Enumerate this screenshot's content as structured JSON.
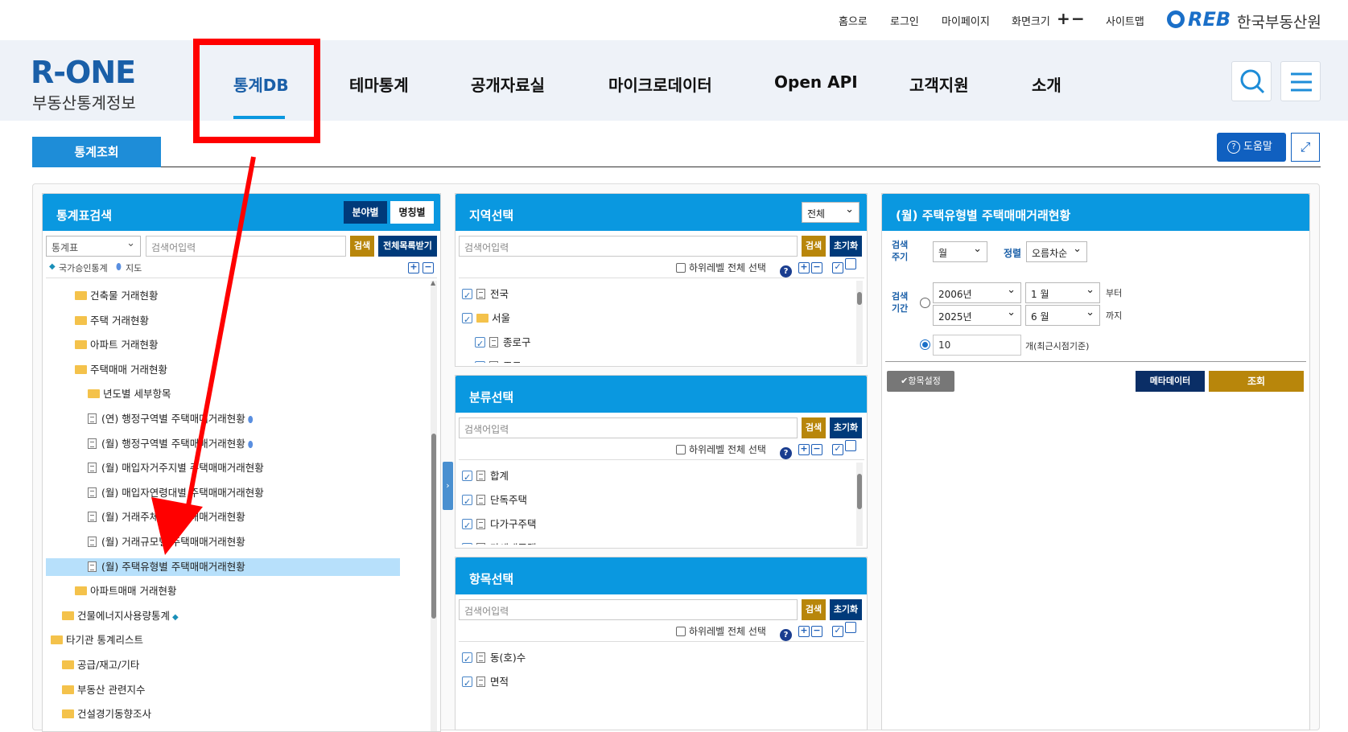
{
  "util": {
    "home": "홈으로",
    "login": "로그인",
    "mypage": "마이페이지",
    "fontsize": "화면크기",
    "plus": "+",
    "minus": "−",
    "sitemap": "사이트맵",
    "org_logo": "REB",
    "org_name": "한국부동산원"
  },
  "logo": {
    "main": "R-ONE",
    "sub": "부동산통계정보"
  },
  "nav": [
    "통계DB",
    "테마통계",
    "공개자료실",
    "마이크로데이터",
    "Open API",
    "고객지원",
    "소개"
  ],
  "sub": {
    "tab": "통계조회",
    "help": "도움말"
  },
  "search_panel": {
    "title": "통계표검색",
    "btn_field": "분야별",
    "btn_name": "명칭별",
    "select_value": "통계표",
    "input_placeholder": "검색어입력",
    "btn_search": "검색",
    "btn_all": "전체목록받기",
    "legend_national": "국가승인통계",
    "legend_map": "지도",
    "tree": [
      {
        "type": "folder",
        "label": "건축물 거래현황",
        "level": 2
      },
      {
        "type": "folder",
        "label": "주택 거래현황",
        "level": 2
      },
      {
        "type": "folder",
        "label": "아파트 거래현황",
        "level": 2
      },
      {
        "type": "folder",
        "label": "주택매매 거래현황",
        "level": 2
      },
      {
        "type": "folder",
        "label": "년도별 세부항목",
        "level": 3
      },
      {
        "type": "doc",
        "label": "(연) 행정구역별 주택매매거래현황",
        "level": 3
      },
      {
        "type": "doc",
        "label": "(월) 행정구역별 주택매매거래현황",
        "level": 3
      },
      {
        "type": "doc",
        "label": "(월) 매입자거주지별 주택매매거래현황",
        "level": 3
      },
      {
        "type": "doc",
        "label": "(월) 매입자연령대별 주택매매거래현황",
        "level": 3
      },
      {
        "type": "doc",
        "label": "(월) 거래주체별 주택매매거래현황",
        "level": 3
      },
      {
        "type": "doc",
        "label": "(월) 거래규모별 주택매매거래현황",
        "level": 3
      },
      {
        "type": "doc",
        "label": "(월) 주택유형별 주택매매거래현황",
        "level": 3
      },
      {
        "type": "folder",
        "label": "아파트매매 거래현황",
        "level": 2
      },
      {
        "type": "folder",
        "label": "건물에너지사용량통계",
        "level": 1
      },
      {
        "type": "folder",
        "label": "타기관 통계리스트",
        "level": 0
      },
      {
        "type": "folder",
        "label": "공급/재고/기타",
        "level": 1
      },
      {
        "type": "folder",
        "label": "부동산 관련지수",
        "level": 1
      },
      {
        "type": "folder",
        "label": "건설경기동향조사",
        "level": 1
      }
    ]
  },
  "region_panel": {
    "title": "지역선택",
    "select_value": "전체",
    "placeholder": "검색어입력",
    "btn_search": "검색",
    "btn_reset": "초기화",
    "sub_all": "하위레벨 전체 선택",
    "items": [
      "전국",
      "서울",
      "종로구",
      "중구"
    ]
  },
  "class_panel": {
    "title": "분류선택",
    "placeholder": "검색어입력",
    "btn_search": "검색",
    "btn_reset": "초기화",
    "sub_all": "하위레벨 전체 선택",
    "items": [
      "합계",
      "단독주택",
      "다가구주택",
      "다세대주택"
    ]
  },
  "item_panel": {
    "title": "항목선택",
    "placeholder": "검색어입력",
    "btn_search": "검색",
    "btn_reset": "초기화",
    "sub_all": "하위레벨 전체 선택",
    "items": [
      "동(호)수",
      "면적"
    ]
  },
  "result_panel": {
    "title": "(월) 주택유형별 주택매매거래현황",
    "cycle_label": "검색주기",
    "cycle_value": "월",
    "sort_label": "정렬",
    "sort_value": "오름차순",
    "period_label": "검색기간",
    "from_year": "2006년",
    "from_month": "1 월",
    "from_suffix": "부터",
    "to_year": "2025년",
    "to_month": "6 월",
    "to_suffix": "까지",
    "recent_value": "10",
    "recent_suffix": "개(최근시점기준)",
    "btn_items": "✔항목설정",
    "btn_meta": "메타데이터",
    "btn_query": "조회"
  },
  "annotation": {
    "highlight_color": "#ff0000"
  }
}
